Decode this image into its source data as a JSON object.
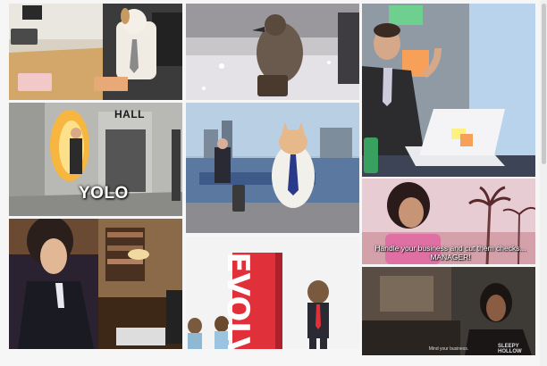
{
  "gifs": [
    {
      "name": "dog-in-office-tie"
    },
    {
      "name": "penguin-with-briefcase"
    },
    {
      "name": "man-with-sticky-notes"
    },
    {
      "name": "burning-man-hallway",
      "caption": "YOLO",
      "sign": "HALL"
    },
    {
      "name": "cat-in-tie-on-street"
    },
    {
      "name": "woman-pink-dress-beach",
      "caption": "Handle your business and cut them checks... MANAGER!"
    },
    {
      "name": "woman-typing-at-desk"
    },
    {
      "name": "evolve-monkeys",
      "sign_text": "EVOLV"
    },
    {
      "name": "woman-in-dim-room",
      "caption": "Mind your business.",
      "watermark": "SLEEPY HOLLOW"
    }
  ],
  "colors": {
    "background": "#f6f6f6",
    "evolve_red": "#e0303a",
    "scroll_thumb": "#c8c8c8"
  }
}
